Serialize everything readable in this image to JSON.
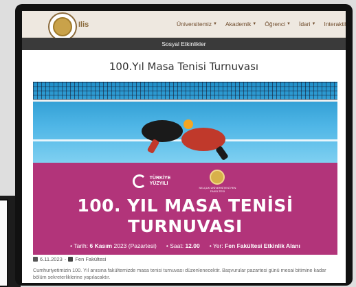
{
  "nav": {
    "logo_text": "Ilis",
    "menu": [
      {
        "label": "Üniversitemiz"
      },
      {
        "label": "Akademik"
      },
      {
        "label": "Öğrenci"
      },
      {
        "label": "İdari"
      },
      {
        "label": "Interaktif"
      }
    ]
  },
  "section_bar": "Sosyal Etkinlikler",
  "page_title": "100.Yıl Masa Tenisi Turnuvası",
  "poster": {
    "ty_line1": "TÜRKİYE",
    "ty_line2": "YÜZYILI",
    "fen_text": "SELÇUK ÜNİVERSİTESİ FEN FAKÜLTESİ",
    "headline_line1": "100. YIL MASA TENİSİ",
    "headline_line2": "TURNUVASI",
    "date_label": "• Tarih:",
    "date_value": "6 Kasım",
    "date_rest": "2023 (Pazartesi)",
    "time_label": "• Saat:",
    "time_value": "12.00",
    "place_label": "• Yer:",
    "place_value": "Fen Fakültesi Etkinlik Alanı"
  },
  "meta": {
    "date": "6.11.2023",
    "separator": "-",
    "category": "Fen Fakültesi"
  },
  "description": "Cumhuriyetimizin 100. Yıl anısına fakültemizde masa tenisi turnuvası düzenlenecektir. Başvurular pazartesi günü mesai bitimine kadar bölüm sekreterliklerine yapılacaktır.",
  "colors": {
    "nav_bg": "#eee8e0",
    "section_bg": "#3a3a3a",
    "poster_magenta": "#b2347a",
    "poster_blue": "#1f8fc9"
  }
}
